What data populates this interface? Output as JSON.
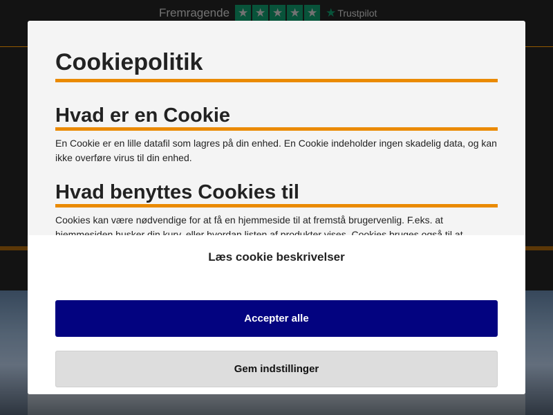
{
  "header": {
    "trust_label": "Fremragende",
    "rating_stars": 5,
    "trustpilot": "Trustpilot",
    "trustpilot_color": "#00b67a"
  },
  "modal": {
    "title": "Cookiepolitik",
    "sections": [
      {
        "heading": "Hvad er en Cookie",
        "text": "En Cookie er en lille datafil som lagres på din enhed. En Cookie indeholder ingen skadelig data, og kan ikke overføre virus til din enhed."
      },
      {
        "heading": "Hvad benyttes Cookies til",
        "text": "Cookies kan være nødvendige for at få en hjemmeside til at fremstå brugervenlig. F.eks. at hjemmesiden husker din kurv, eller hvordan listen af produkter vises. Cookies bruges også til at indsamle information"
      }
    ],
    "read_descriptions": "Læs cookie beskrivelser",
    "accept_all": "Accepter alle",
    "save_settings": "Gem indstillinger"
  },
  "colors": {
    "accent": "#ea8a00",
    "primary_button": "#030380"
  }
}
